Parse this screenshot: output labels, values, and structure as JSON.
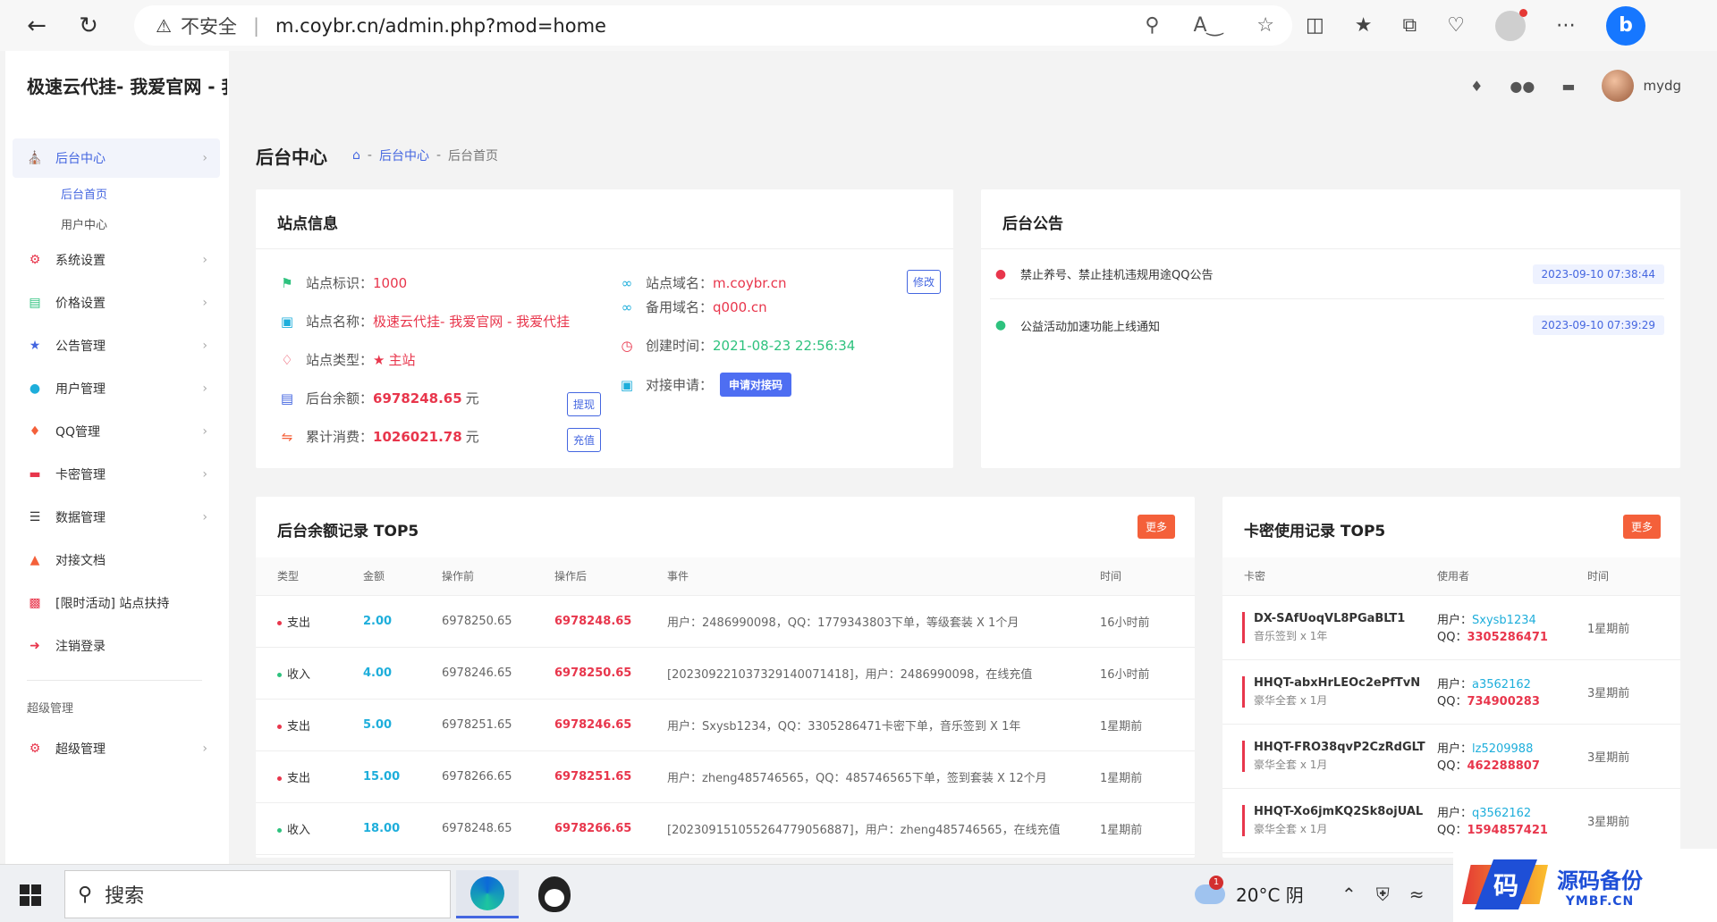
{
  "browser": {
    "insecure_label": "不安全",
    "url": "m.coybr.cn/admin.php?mod=home"
  },
  "sidebar": {
    "brand": "极速云代挂- 我爱官网 - 我",
    "items": [
      {
        "label": "后台中心"
      },
      {
        "label": "系统设置"
      },
      {
        "label": "价格设置"
      },
      {
        "label": "公告管理"
      },
      {
        "label": "用户管理"
      },
      {
        "label": "QQ管理"
      },
      {
        "label": "卡密管理"
      },
      {
        "label": "数据管理"
      },
      {
        "label": "对接文档"
      },
      {
        "label": "[限时活动] 站点扶持"
      },
      {
        "label": "注销登录"
      }
    ],
    "submenu": [
      {
        "label": "后台首页"
      },
      {
        "label": "用户中心"
      }
    ],
    "section_label": "超级管理",
    "super_item": "超级管理"
  },
  "header": {
    "username": "mydg"
  },
  "page": {
    "title": "后台中心",
    "breadcrumb": [
      "后台中心",
      "后台首页"
    ]
  },
  "site_info": {
    "title": "站点信息",
    "id_label": "站点标识：",
    "id_value": "1000",
    "name_label": "站点名称：",
    "name_value": "极速云代挂- 我爱官网 - 我爱代挂",
    "type_label": "站点类型：",
    "type_value": "主站",
    "balance_label": "后台余额：",
    "balance_value": "6978248.65",
    "balance_unit": "元",
    "spent_label": "累计消费：",
    "spent_value": "1026021.78",
    "spent_unit": "元",
    "domain_label": "站点域名：",
    "domain_value": "m.coybr.cn",
    "backup_label": "备用域名：",
    "backup_value": "q000.cn",
    "created_label": "创建时间：",
    "created_value": "2021-08-23 22:56:34",
    "apply_label": "对接申请：",
    "apply_button": "申请对接码",
    "edit_button": "修改",
    "withdraw_button": "提现",
    "recharge_button": "充值"
  },
  "notices": {
    "title": "后台公告",
    "items": [
      {
        "text": "禁止养号、禁止挂机违规用途QQ公告",
        "date": "2023-09-10 07:38:44"
      },
      {
        "text": "公益活动加速功能上线通知",
        "date": "2023-09-10 07:39:29"
      }
    ]
  },
  "balance_log": {
    "title": "后台余额记录 TOP5",
    "more": "更多",
    "headers": [
      "类型",
      "金额",
      "操作前",
      "操作后",
      "事件",
      "时间"
    ],
    "rows": [
      {
        "type": "支出",
        "amount": "2.00",
        "before": "6978250.65",
        "after": "6978248.65",
        "event": "用户：2486990098，QQ：1779343803下单，等级套装 X 1个月",
        "time": "16小时前"
      },
      {
        "type": "收入",
        "amount": "4.00",
        "before": "6978246.65",
        "after": "6978250.65",
        "event": "[20230922103732914007141​8]，用户：2486990098，在线充值",
        "time": "16小时前"
      },
      {
        "type": "支出",
        "amount": "5.00",
        "before": "6978251.65",
        "after": "6978246.65",
        "event": "用户：Sxysb1234，QQ：3305286471卡密下单，音乐签到 X 1年",
        "time": "1星期前"
      },
      {
        "type": "支出",
        "amount": "15.00",
        "before": "6978266.65",
        "after": "6978251.65",
        "event": "用户：zheng485746565，QQ：485746565下单，签到套装 X 12个月",
        "time": "1星期前"
      },
      {
        "type": "收入",
        "amount": "18.00",
        "before": "6978248.65",
        "after": "6978266.65",
        "event": "[20230915105526477905688​7]，用户：zheng485746565，在线充值",
        "time": "1星期前"
      }
    ]
  },
  "card_log": {
    "title": "卡密使用记录 TOP5",
    "more": "更多",
    "headers": [
      "卡密",
      "使用者",
      "时间"
    ],
    "user_prefix": "用户：",
    "qq_prefix": "QQ：",
    "rows": [
      {
        "code": "DX-SAfUoqVL8PGaBLT1",
        "desc": "音乐签到 x 1年",
        "user": "Sxysb1234",
        "qq": "3305286471",
        "time": "1星期前"
      },
      {
        "code": "HHQT-abxHrLEOc2ePfTvN",
        "desc": "豪华全套 x 1月",
        "user": "a3562162",
        "qq": "734900283",
        "time": "3星期前"
      },
      {
        "code": "HHQT-FRO38qvP2CzRdGLT",
        "desc": "豪华全套 x 1月",
        "user": "lz5209988",
        "qq": "462288807",
        "time": "3星期前"
      },
      {
        "code": "HHQT-Xo6jmKQ2Sk8ojUAL",
        "desc": "豪华全套 x 1月",
        "user": "q3562162",
        "qq": "1594857421",
        "time": "3星期前"
      }
    ]
  },
  "taskbar": {
    "search_label": "搜索",
    "weather": "20°C 阴",
    "weather_badge": "1"
  },
  "watermark": {
    "logo_char": "码",
    "title": "源码备份",
    "sub": "YMBF.CN"
  }
}
